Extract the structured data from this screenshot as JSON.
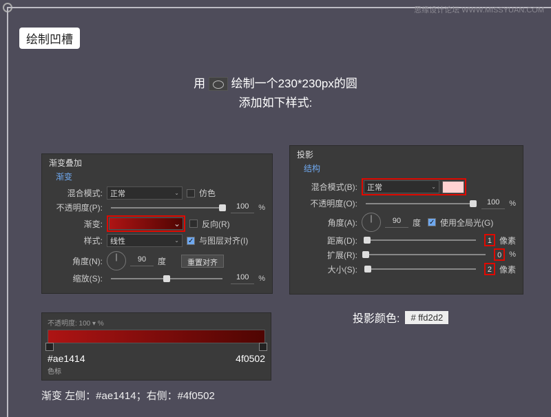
{
  "watermark": "思缘设计论坛  WWW.MISSYUAN.COM",
  "title_chip": "绘制凹槽",
  "instr_line1_pre": "用",
  "instr_line1_post": "绘制一个230*230px的圆",
  "instr_line2": "添加如下样式:",
  "left": {
    "panel_title": "渐变叠加",
    "sub": "渐变",
    "blend_label": "混合模式:",
    "blend_value": "正常",
    "dither": "仿色",
    "opacity_label": "不透明度(P):",
    "opacity_value": "100",
    "pct": "%",
    "grad_label": "渐变:",
    "reverse": "反向(R)",
    "style_label": "样式:",
    "style_value": "线性",
    "align": "与图层对齐(I)",
    "angle_label": "角度(N):",
    "angle_value": "90",
    "degree": "度",
    "reset_btn": "重置对齐",
    "scale_label": "缩放(S):",
    "scale_value": "100"
  },
  "right": {
    "panel_title": "投影",
    "sub": "结构",
    "blend_label": "混合模式(B):",
    "blend_value": "正常",
    "opacity_label": "不透明度(O):",
    "opacity_value": "100",
    "pct": "%",
    "angle_label": "角度(A):",
    "angle_value": "90",
    "degree": "度",
    "global": "使用全局光(G)",
    "distance_label": "距离(D):",
    "distance_value": "1",
    "px": "像素",
    "spread_label": "扩展(R):",
    "spread_value": "0",
    "size_label": "大小(S):",
    "size_value": "2"
  },
  "grad_editor": {
    "top": "不透明度: 100 ▾ %",
    "left_hex": "#ae1414",
    "right_hex": "4f0502",
    "sub": "色标"
  },
  "footer1": "渐变 左侧：#ae1414；右侧：#4f0502",
  "shadow_note_label": "投影颜色:",
  "shadow_note_hex": "# ffd2d2"
}
